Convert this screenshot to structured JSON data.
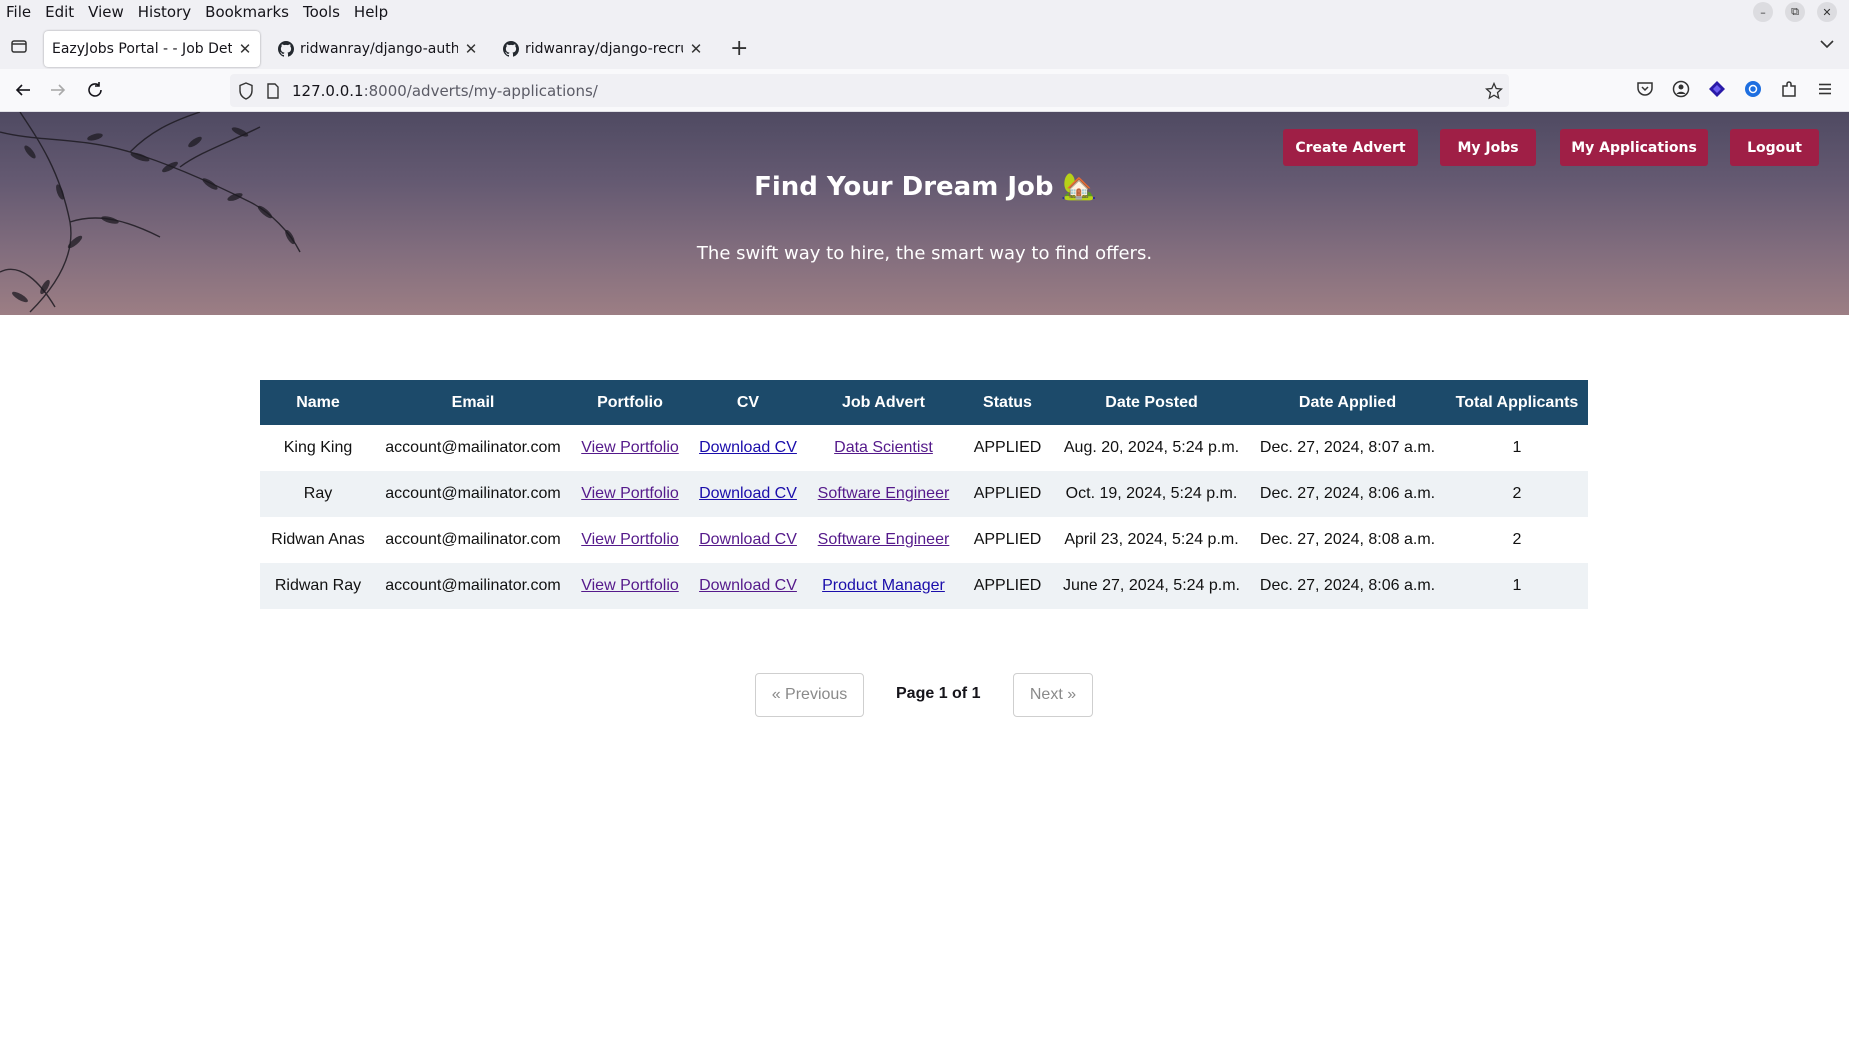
{
  "menubar": {
    "items": [
      "File",
      "Edit",
      "View",
      "History",
      "Bookmarks",
      "Tools",
      "Help"
    ]
  },
  "tabs": [
    {
      "title": "EazyJobs Portal - - Job Detai",
      "active": true,
      "icon": "none"
    },
    {
      "title": "ridwanray/django-auth: A",
      "active": false,
      "icon": "github-icon"
    },
    {
      "title": "ridwanray/django-recruit",
      "active": false,
      "icon": "github-icon"
    }
  ],
  "urlbar": {
    "host": "127.0.0.1",
    "rest": ":8000/adverts/my-applications/"
  },
  "hero": {
    "title": "Find Your Dream Job",
    "emoji": "🏡",
    "subtitle": "The swift way to hire, the smart way to find offers.",
    "buttons": {
      "create_advert": "Create Advert",
      "my_jobs": "My Jobs",
      "my_applications": "My Applications",
      "logout": "Logout"
    },
    "button_color": "#9f1f46"
  },
  "table": {
    "headers": [
      "Name",
      "Email",
      "Portfolio",
      "CV",
      "Job Advert",
      "Status",
      "Date Posted",
      "Date Applied",
      "Total Applicants"
    ],
    "rows": [
      {
        "name": "King King",
        "email": "account@mailinator.com",
        "portfolio": "View Portfolio",
        "cv": "Download CV",
        "job": "Data Scientist",
        "status": "APPLIED",
        "posted": "Aug. 20, 2024, 5:24 p.m.",
        "applied": "Dec. 27, 2024, 8:07 a.m.",
        "total": "1"
      },
      {
        "name": "Ray",
        "email": "account@mailinator.com",
        "portfolio": "View Portfolio",
        "cv": "Download CV",
        "job": "Software Engineer",
        "status": "APPLIED",
        "posted": "Oct. 19, 2024, 5:24 p.m.",
        "applied": "Dec. 27, 2024, 8:06 a.m.",
        "total": "2"
      },
      {
        "name": "Ridwan Anas",
        "email": "account@mailinator.com",
        "portfolio": "View Portfolio",
        "cv": "Download CV",
        "job": "Software Engineer",
        "status": "APPLIED",
        "posted": "April 23, 2024, 5:24 p.m.",
        "applied": "Dec. 27, 2024, 8:08 a.m.",
        "total": "2"
      },
      {
        "name": "Ridwan Ray",
        "email": "account@mailinator.com",
        "portfolio": "View Portfolio",
        "cv": "Download CV",
        "job": "Product Manager",
        "status": "APPLIED",
        "posted": "June 27, 2024, 5:24 p.m.",
        "applied": "Dec. 27, 2024, 8:06 a.m.",
        "total": "1"
      }
    ],
    "header_color": "#1c4a6a"
  },
  "pagination": {
    "previous": "« Previous",
    "label": "Page 1 of 1",
    "next": "Next »"
  }
}
